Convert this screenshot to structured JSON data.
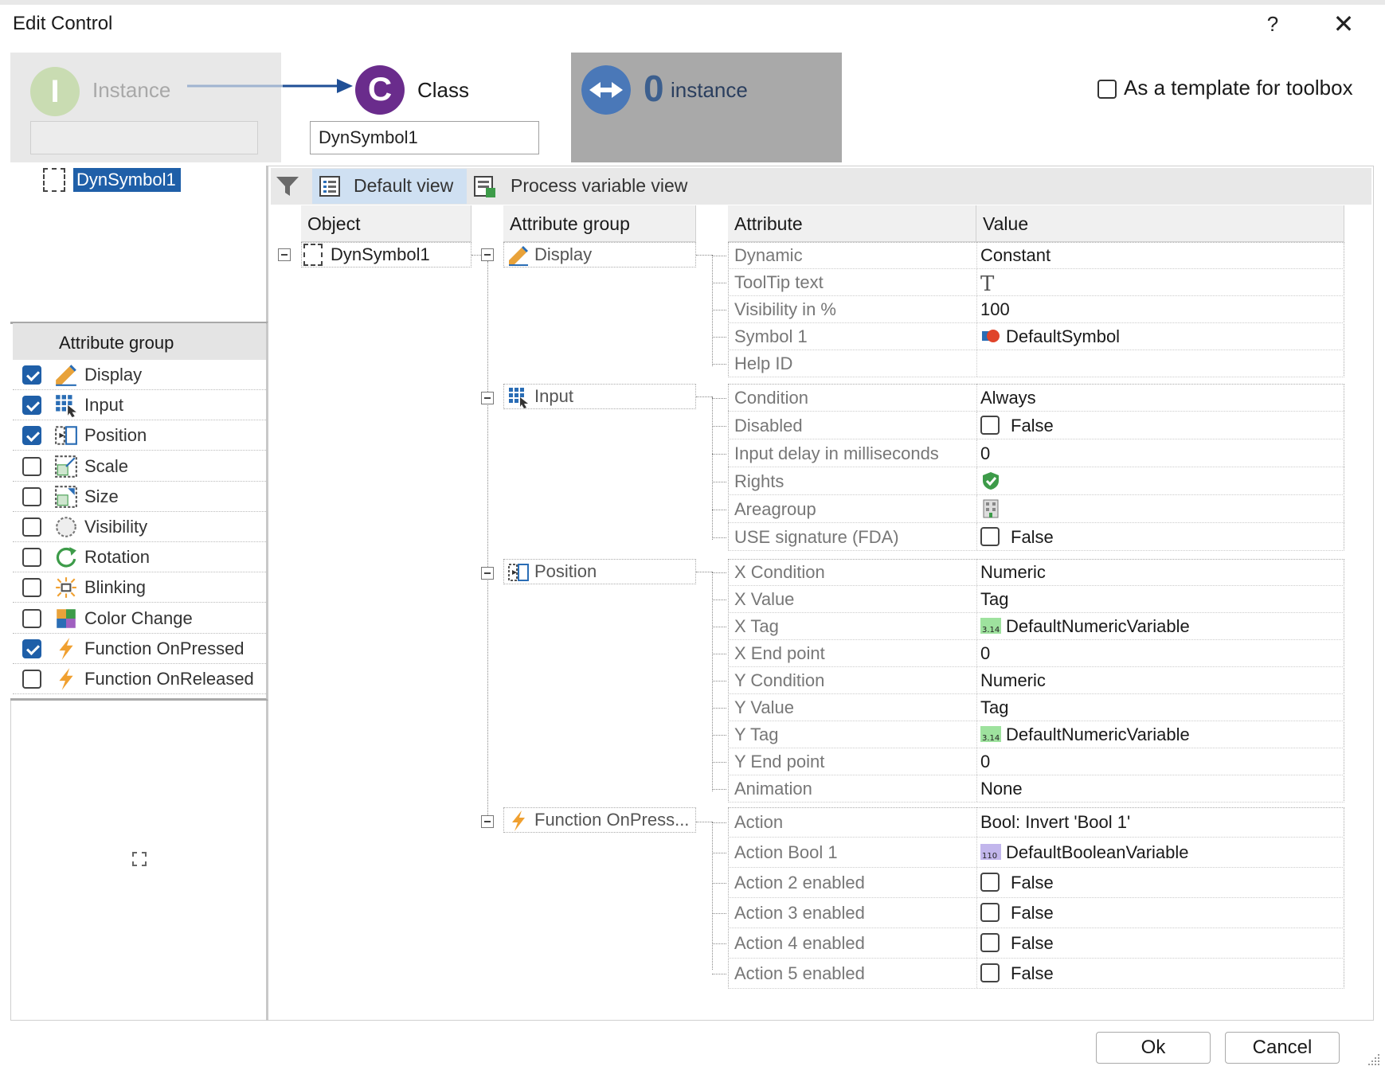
{
  "window": {
    "title": "Edit Control",
    "help_glyph": "?",
    "close_glyph": "✕"
  },
  "header": {
    "instance_letter": "I",
    "instance_label": "Instance",
    "class_letter": "C",
    "class_label": "Class",
    "class_value": "DynSymbol1",
    "instance_count": "0",
    "instance_count_label": "instance",
    "template_label": "As a template for toolbox"
  },
  "object_tree": {
    "selected": "DynSymbol1"
  },
  "attribute_groups": {
    "header": "Attribute group",
    "items": [
      {
        "label": "Display",
        "checked": true,
        "icon": "pencil-ruler-icon"
      },
      {
        "label": "Input",
        "checked": true,
        "icon": "input-grid-icon"
      },
      {
        "label": "Position",
        "checked": true,
        "icon": "position-icon"
      },
      {
        "label": "Scale",
        "checked": false,
        "icon": "scale-icon"
      },
      {
        "label": "Size",
        "checked": false,
        "icon": "size-icon"
      },
      {
        "label": "Visibility",
        "checked": false,
        "icon": "visibility-icon"
      },
      {
        "label": "Rotation",
        "checked": false,
        "icon": "rotation-icon"
      },
      {
        "label": "Blinking",
        "checked": false,
        "icon": "blinking-icon"
      },
      {
        "label": "Color Change",
        "checked": false,
        "icon": "color-change-icon"
      },
      {
        "label": "Function OnPressed",
        "checked": true,
        "icon": "lightning-icon"
      },
      {
        "label": "Function OnReleased",
        "checked": false,
        "icon": "lightning-icon"
      }
    ]
  },
  "toolbar": {
    "default_view": "Default view",
    "process_variable_view": "Process variable view"
  },
  "columns": {
    "object": "Object",
    "attribute_group": "Attribute group",
    "attribute": "Attribute",
    "value": "Value"
  },
  "tree": {
    "object": "DynSymbol1",
    "groups": {
      "display": "Display",
      "input": "Input",
      "position": "Position",
      "function": "Function OnPress..."
    }
  },
  "attributes": {
    "display": [
      {
        "name": "Dynamic",
        "value": "Constant"
      },
      {
        "name": "ToolTip text",
        "value": "T"
      },
      {
        "name": "Visibility in %",
        "value": "100"
      },
      {
        "name": "Symbol 1",
        "value": "DefaultSymbol"
      },
      {
        "name": "Help ID",
        "value": ""
      }
    ],
    "input": [
      {
        "name": "Condition",
        "value": "Always"
      },
      {
        "name": "Disabled",
        "value": "False"
      },
      {
        "name": "Input delay in milliseconds",
        "value": "0"
      },
      {
        "name": "Rights",
        "value": ""
      },
      {
        "name": "Areagroup",
        "value": ""
      },
      {
        "name": "USE signature (FDA)",
        "value": "False"
      }
    ],
    "position": [
      {
        "name": "X Condition",
        "value": "Numeric"
      },
      {
        "name": "X Value",
        "value": "Tag"
      },
      {
        "name": "X Tag",
        "value": "DefaultNumericVariable"
      },
      {
        "name": "X End point",
        "value": "0"
      },
      {
        "name": "Y Condition",
        "value": "Numeric"
      },
      {
        "name": "Y Value",
        "value": "Tag"
      },
      {
        "name": "Y Tag",
        "value": "DefaultNumericVariable"
      },
      {
        "name": "Y End point",
        "value": "0"
      },
      {
        "name": "Animation",
        "value": "None"
      }
    ],
    "function": [
      {
        "name": "Action",
        "value": "Bool: Invert 'Bool 1'"
      },
      {
        "name": "Action Bool 1",
        "value": "DefaultBooleanVariable"
      },
      {
        "name": "Action 2 enabled",
        "value": "False"
      },
      {
        "name": "Action 3 enabled",
        "value": "False"
      },
      {
        "name": "Action 4 enabled",
        "value": "False"
      },
      {
        "name": "Action 5 enabled",
        "value": "False"
      }
    ]
  },
  "icon_text": {
    "numeric": "3.14",
    "boolean": "110"
  },
  "footer": {
    "ok": "Ok",
    "cancel": "Cancel"
  }
}
